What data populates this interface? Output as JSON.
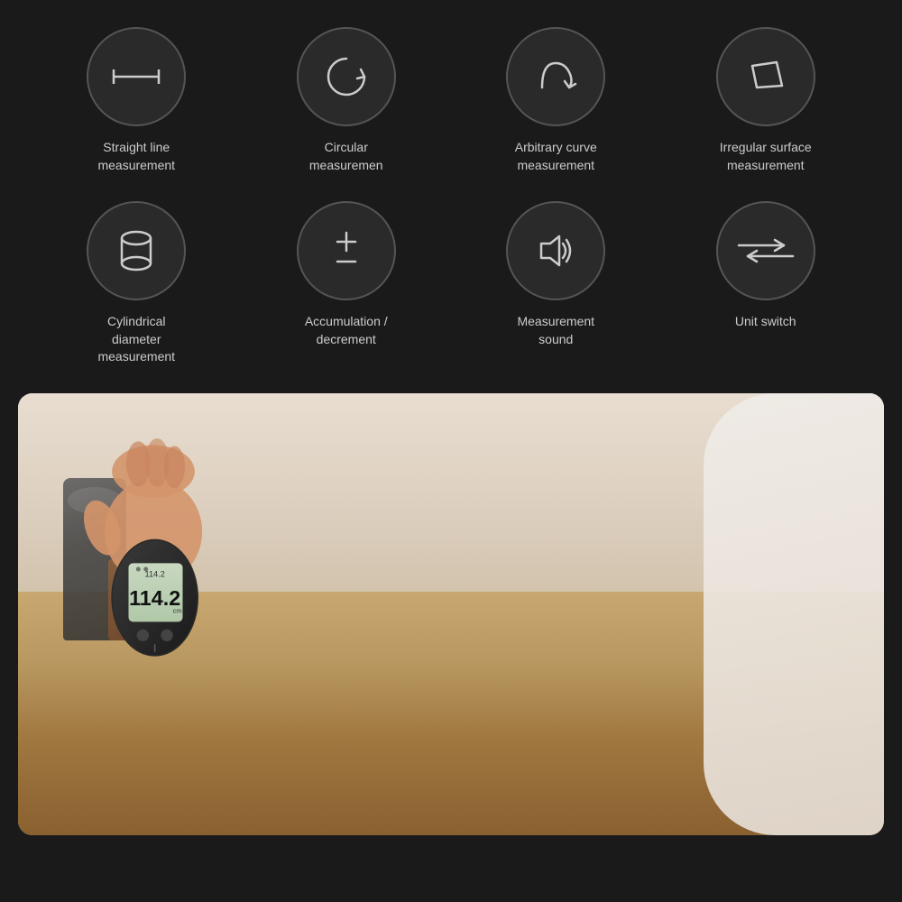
{
  "background": "#1a1a1a",
  "features": {
    "row1": [
      {
        "id": "straight-line",
        "label": "Straight line\nmeasurement",
        "icon": "straight-line-icon"
      },
      {
        "id": "circular",
        "label": "Circular\nmeasuremen",
        "icon": "circular-icon"
      },
      {
        "id": "arbitrary-curve",
        "label": "Arbitrary curve\nmeasurement",
        "icon": "arbitrary-curve-icon"
      },
      {
        "id": "irregular-surface",
        "label": "Irregular surface\nmeasurement",
        "icon": "irregular-surface-icon"
      }
    ],
    "row2": [
      {
        "id": "cylindrical",
        "label": "Cylindrical\ndiameter\nmeasurement",
        "icon": "cylindrical-icon"
      },
      {
        "id": "accumulation",
        "label": "Accumulation /\ndecrement",
        "icon": "accumulation-icon"
      },
      {
        "id": "measurement-sound",
        "label": "Measurement\nsound",
        "icon": "sound-icon"
      },
      {
        "id": "unit-switch",
        "label": "Unit switch",
        "icon": "unit-switch-icon"
      }
    ]
  },
  "device": {
    "screen_top": "114.2",
    "screen_main": "114.2",
    "unit": "cm"
  }
}
